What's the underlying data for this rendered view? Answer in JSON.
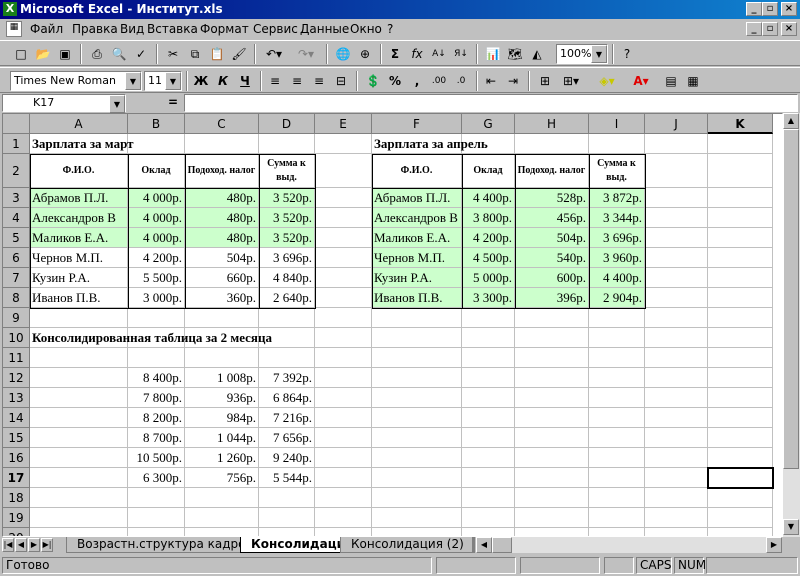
{
  "window": {
    "title": "Microsoft Excel - Институт.xls"
  },
  "menu": [
    "Файл",
    "Правка",
    "Вид",
    "Вставка",
    "Формат",
    "Сервис",
    "Данные",
    "Окно",
    "?"
  ],
  "toolbar": {
    "zoom": "100%",
    "font": "Times New Roman",
    "size": "11",
    "bold": "Ж",
    "italic": "К",
    "underline": "Ч",
    "sigma": "Σ",
    "fx": "fx",
    "percent": "%",
    "comma": ","
  },
  "formula": {
    "namebox": "K17",
    "eq": "=",
    "value": ""
  },
  "columns": [
    "A",
    "B",
    "C",
    "D",
    "E",
    "F",
    "G",
    "H",
    "I",
    "J",
    "K"
  ],
  "rows": [
    "1",
    "2",
    "3",
    "4",
    "5",
    "6",
    "7",
    "8",
    "9",
    "10",
    "11",
    "12",
    "13",
    "14",
    "15",
    "16",
    "17",
    "18",
    "19",
    "20"
  ],
  "march": {
    "title": "Зарплата за март",
    "headers": [
      "Ф.И.О.",
      "Оклад",
      "Подоход. налог",
      "Сумма к выд."
    ],
    "rows": [
      [
        "Абрамов П.Л.",
        "4 000р.",
        "480р.",
        "3 520р."
      ],
      [
        "Александров В",
        "4 000р.",
        "480р.",
        "3 520р."
      ],
      [
        "Маликов Е.А.",
        "4 000р.",
        "480р.",
        "3 520р."
      ],
      [
        "Чернов М.П.",
        "4 200р.",
        "504р.",
        "3 696р."
      ],
      [
        "Кузин Р.А.",
        "5 500р.",
        "660р.",
        "4 840р."
      ],
      [
        "Иванов П.В.",
        "3 000р.",
        "360р.",
        "2 640р."
      ]
    ]
  },
  "april": {
    "title": "Зарплата за апрель",
    "headers": [
      "Ф.И.О.",
      "Оклад",
      "Подоход. налог",
      "Сумма к выд."
    ],
    "rows": [
      [
        "Абрамов П.Л.",
        "4 400р.",
        "528р.",
        "3 872р."
      ],
      [
        "Александров В",
        "3 800р.",
        "456р.",
        "3 344р."
      ],
      [
        "Маликов Е.А.",
        "4 200р.",
        "504р.",
        "3 696р."
      ],
      [
        "Чернов М.П.",
        "4 500р.",
        "540р.",
        "3 960р."
      ],
      [
        "Кузин Р.А.",
        "5 000р.",
        "600р.",
        "4 400р."
      ],
      [
        "Иванов П.В.",
        "3 300р.",
        "396р.",
        "2 904р."
      ]
    ]
  },
  "consolidated": {
    "title": "Консолидированная таблица за 2 месяца",
    "rows": [
      [
        "8 400р.",
        "1 008р.",
        "7 392р."
      ],
      [
        "7 800р.",
        "936р.",
        "6 864р."
      ],
      [
        "8 200р.",
        "984р.",
        "7 216р."
      ],
      [
        "8 700р.",
        "1 044р.",
        "7 656р."
      ],
      [
        "10 500р.",
        "1 260р.",
        "9 240р."
      ],
      [
        "6 300р.",
        "756р.",
        "5 544р."
      ]
    ]
  },
  "tabs": [
    "Возрастн.структура кадров",
    "Консолидация",
    "Консолидация (2)"
  ],
  "status": {
    "ready": "Готово",
    "caps": "CAPS",
    "num": "NUM"
  }
}
